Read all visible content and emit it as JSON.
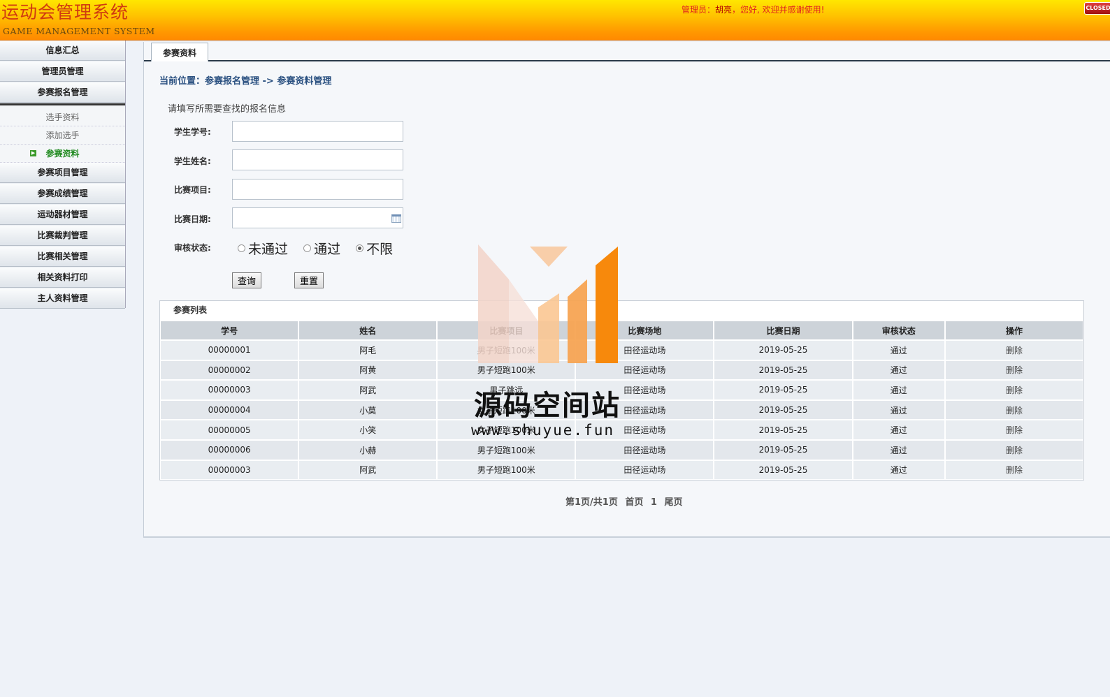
{
  "header": {
    "title": "运动会管理系统",
    "subtitle": "GAME MANAGEMENT SYSTEM",
    "welcome_prefix": "管理员：",
    "admin_name": "胡亮",
    "welcome_suffix": "，您好, 欢迎并感谢使用!",
    "close_label": "CLOSED"
  },
  "sidebar": {
    "items": [
      {
        "label": "信息汇总"
      },
      {
        "label": "管理员管理"
      },
      {
        "label": "参赛报名管理"
      }
    ],
    "submenu": [
      {
        "label": "选手资料"
      },
      {
        "label": "添加选手"
      },
      {
        "label": "参赛资料",
        "active": true
      }
    ],
    "items_after": [
      {
        "label": "参赛项目管理"
      },
      {
        "label": "参赛成绩管理"
      },
      {
        "label": "运动器材管理"
      },
      {
        "label": "比赛裁判管理"
      },
      {
        "label": "比赛相关管理"
      },
      {
        "label": "相关资料打印"
      },
      {
        "label": "主人资料管理"
      }
    ]
  },
  "main": {
    "tab": "参赛资料",
    "breadcrumb": "当前位置：参赛报名管理 -> 参赛资料管理",
    "search": {
      "title": "请填写所需要查找的报名信息",
      "student_id_label": "学生学号:",
      "student_id_value": "",
      "student_name_label": "学生姓名:",
      "student_name_value": "",
      "event_label": "比赛项目:",
      "event_value": "",
      "date_label": "比赛日期:",
      "date_value": "",
      "status_label": "审核状态:",
      "status_options": [
        "未通过",
        "通过",
        "不限"
      ],
      "status_selected": "不限",
      "query_button": "查询",
      "reset_button": "重置"
    },
    "list": {
      "title": "参赛列表",
      "columns": [
        "学号",
        "姓名",
        "比赛项目",
        "比赛场地",
        "比赛日期",
        "审核状态",
        "操作"
      ],
      "rows": [
        [
          "00000001",
          "阿毛",
          "男子短跑100米",
          "田径运动场",
          "2019-05-25",
          "通过",
          "删除"
        ],
        [
          "00000002",
          "阿黄",
          "男子短跑100米",
          "田径运动场",
          "2019-05-25",
          "通过",
          "删除"
        ],
        [
          "00000003",
          "阿武",
          "男子跳远",
          "田径运动场",
          "2019-05-25",
          "通过",
          "删除"
        ],
        [
          "00000004",
          "小莫",
          "女子短跑100米",
          "田径运动场",
          "2019-05-25",
          "通过",
          "删除"
        ],
        [
          "00000005",
          "小笑",
          "女子短跑100米",
          "田径运动场",
          "2019-05-25",
          "通过",
          "删除"
        ],
        [
          "00000006",
          "小赫",
          "男子短跑100米",
          "田径运动场",
          "2019-05-25",
          "通过",
          "删除"
        ],
        [
          "00000003",
          "阿武",
          "男子短跑100米",
          "田径运动场",
          "2019-05-25",
          "通过",
          "删除"
        ]
      ]
    },
    "pagination": {
      "page_info": "第1页/共1页",
      "first": "首页",
      "current": "1",
      "last": "尾页"
    }
  },
  "watermark": {
    "text": "源码空间站",
    "url": "www.shuyue.fun"
  },
  "colors": {
    "header_top": "#ffe700",
    "header_bottom": "#ff8a00",
    "active_green": "#228b22",
    "watermark_orange": "#f7890c"
  }
}
